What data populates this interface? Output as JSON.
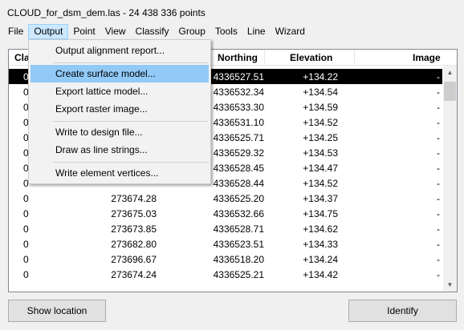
{
  "window": {
    "title": "CLOUD_for_dsm_dem.las - 24 438 336 points"
  },
  "menubar": {
    "file": "File",
    "output": "Output",
    "point": "Point",
    "view": "View",
    "classify": "Classify",
    "group": "Group",
    "tools": "Tools",
    "line": "Line",
    "wizard": "Wizard"
  },
  "output_menu": {
    "alignment_report": "Output alignment report...",
    "surface_model": "Create surface model...",
    "lattice_model": "Export lattice model...",
    "raster_image": "Export raster image...",
    "design_file": "Write to design file...",
    "line_strings": "Draw as line strings...",
    "element_vertices": "Write element vertices..."
  },
  "table": {
    "columns": {
      "class": "Cla",
      "northing": "Northing",
      "elevation": "Elevation",
      "image": "Image"
    },
    "rows": [
      {
        "class": "0",
        "easting": "",
        "northing": "4336527.51",
        "elevation": "+134.22",
        "image": "-"
      },
      {
        "class": "0",
        "easting": "",
        "northing": "4336532.34",
        "elevation": "+134.54",
        "image": "-"
      },
      {
        "class": "0",
        "easting": "",
        "northing": "4336533.30",
        "elevation": "+134.59",
        "image": "-"
      },
      {
        "class": "0",
        "easting": "",
        "northing": "4336531.10",
        "elevation": "+134.52",
        "image": "-"
      },
      {
        "class": "0",
        "easting": "",
        "northing": "4336525.71",
        "elevation": "+134.25",
        "image": "-"
      },
      {
        "class": "0",
        "easting": "",
        "northing": "4336529.32",
        "elevation": "+134.53",
        "image": "-"
      },
      {
        "class": "0",
        "easting": "",
        "northing": "4336528.45",
        "elevation": "+134.47",
        "image": "-"
      },
      {
        "class": "0",
        "easting": "",
        "northing": "4336528.44",
        "elevation": "+134.52",
        "image": "-"
      },
      {
        "class": "0",
        "easting": "273674.28",
        "northing": "4336525.20",
        "elevation": "+134.37",
        "image": "-"
      },
      {
        "class": "0",
        "easting": "273675.03",
        "northing": "4336532.66",
        "elevation": "+134.75",
        "image": "-"
      },
      {
        "class": "0",
        "easting": "273673.85",
        "northing": "4336528.71",
        "elevation": "+134.62",
        "image": "-"
      },
      {
        "class": "0",
        "easting": "273682.80",
        "northing": "4336523.51",
        "elevation": "+134.33",
        "image": "-"
      },
      {
        "class": "0",
        "easting": "273696.67",
        "northing": "4336518.20",
        "elevation": "+134.24",
        "image": "-"
      },
      {
        "class": "0",
        "easting": "273674.24",
        "northing": "4336525.21",
        "elevation": "+134.42",
        "image": "-"
      }
    ]
  },
  "buttons": {
    "show_location": "Show location",
    "identify": "Identify"
  },
  "colors": {
    "selected_row": "#000000",
    "menu_hover": "#91c9f7",
    "menu_active": "#cce8ff"
  }
}
